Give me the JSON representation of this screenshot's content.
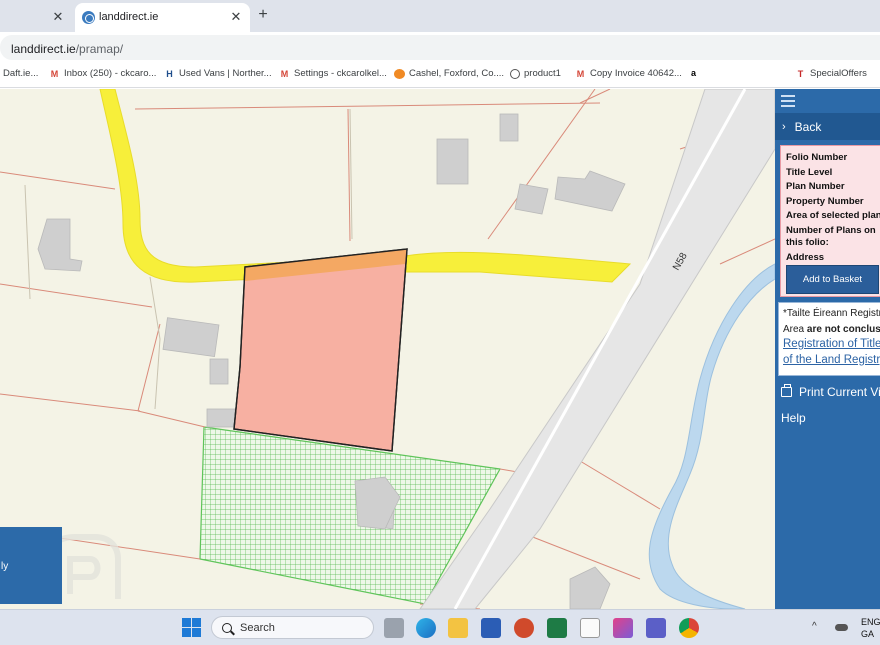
{
  "browser": {
    "tabs": [
      {
        "title": "",
        "active": false
      },
      {
        "title": "landdirect.ie",
        "active": true
      }
    ],
    "close_glyph": "✕",
    "new_tab_glyph": "+",
    "url_host": "landdirect.ie",
    "url_path": "/pramap/"
  },
  "bookmarks": [
    {
      "label": "Daft.ie...",
      "icon": "none"
    },
    {
      "label": "Inbox (250) - ckcaro...",
      "icon": "gmail-icon",
      "glyph": "M"
    },
    {
      "label": "Used Vans | Norther...",
      "icon": "h-icon",
      "glyph": "H"
    },
    {
      "label": "Settings - ckcarolkel...",
      "icon": "gmail-icon",
      "glyph": "M"
    },
    {
      "label": "Cashel, Foxford, Co....",
      "icon": "cashel-icon",
      "glyph": ""
    },
    {
      "label": "product1",
      "icon": "globe-icon",
      "glyph": ""
    },
    {
      "label": "Copy Invoice 40642...",
      "icon": "gmail-icon",
      "glyph": "M"
    },
    {
      "label": "",
      "icon": "amazon-icon",
      "glyph": "a"
    },
    {
      "label": "SpecialOffers",
      "icon": "t-icon",
      "glyph": "T"
    }
  ],
  "map": {
    "road_label": "N58",
    "colors": {
      "background": "#f4f3e6",
      "road_yellow": "#f7ef3a",
      "selected_plot": "#f7b0a2",
      "plot_strip": "#f4a863",
      "green_plot": "#5fc45a",
      "boundary": "#d98a7a",
      "river": "#bcd8ee",
      "building": "#cfcfcf"
    }
  },
  "panel": {
    "back_label": "Back",
    "info_labels": {
      "folio": "Folio Number",
      "title_level": "Title Level",
      "plan": "Plan Number",
      "property": "Property Number",
      "area": "Area of selected plans",
      "num_plans_1": "Number of Plans on",
      "num_plans_2": "this folio:",
      "address": "Address"
    },
    "add_basket": "Add to Basket",
    "notice": {
      "line1": "*Tailte Éireann Registra",
      "line2_pre": "Area ",
      "line2_bold": "are not conclusive",
      "link1": "Registration of Title",
      "link2": "of the Land Registry"
    },
    "print_label": "Print Current View",
    "help_label": "Help",
    "colors": {
      "panel": "#2c6aa9",
      "info_bg": "#fbe3e6"
    }
  },
  "left_overlay": {
    "text": "ly"
  },
  "taskbar": {
    "search_placeholder": "Search",
    "tray_chevron": "^",
    "lang_line1": "ENG",
    "lang_line2": "GA",
    "apps": [
      "task-view-icon",
      "edge-icon",
      "file-explorer-icon",
      "word-icon",
      "powerpoint-icon",
      "excel-icon",
      "notepad-icon",
      "photos-icon",
      "teams-icon",
      "chrome-icon"
    ]
  }
}
